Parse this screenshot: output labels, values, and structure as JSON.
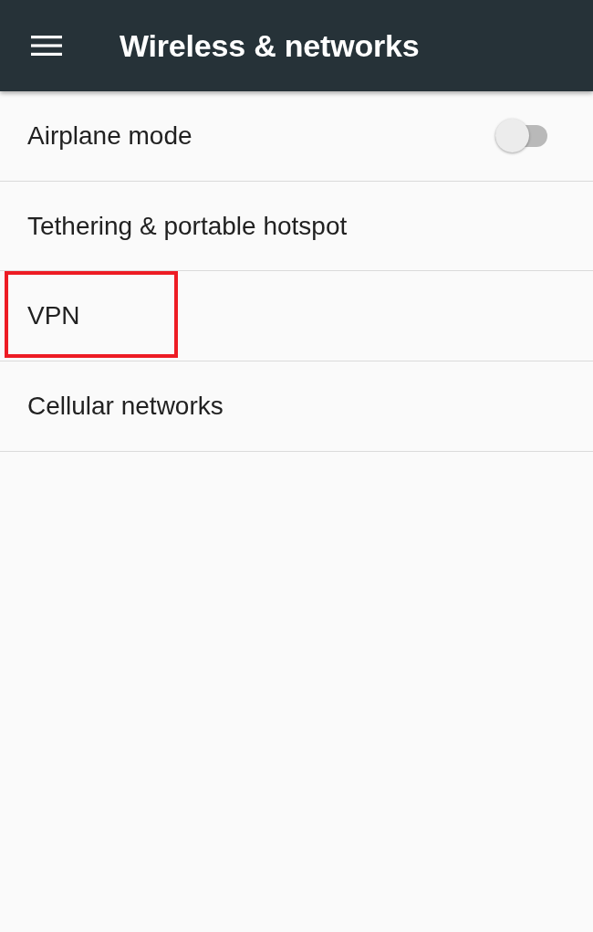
{
  "app_bar": {
    "title": "Wireless & networks"
  },
  "items": [
    {
      "kind": "toggle",
      "label": "Airplane mode",
      "on": false,
      "highlighted": false
    },
    {
      "kind": "link",
      "label": "Tethering & portable hotspot",
      "highlighted": false
    },
    {
      "kind": "link",
      "label": "VPN",
      "highlighted": true
    },
    {
      "kind": "link",
      "label": "Cellular networks",
      "highlighted": false
    }
  ]
}
